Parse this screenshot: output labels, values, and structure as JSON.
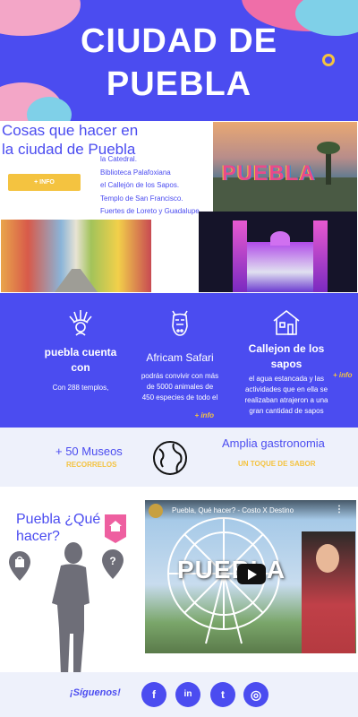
{
  "hero": {
    "title_line1": "CIUDAD DE",
    "title_line2": "PUEBLA"
  },
  "intro": {
    "heading": "Cosas que hacer en la ciudad de Puebla",
    "more_button": "+ INFO",
    "places": [
      "la Catedral.",
      "Biblioteca Palafoxiana",
      "el Callejón de los Sapos.",
      "Templo de San Francisco.",
      "Fuertes de Loreto y Guadalupe."
    ]
  },
  "photos": {
    "sign_text": "PUEBLA"
  },
  "features": [
    {
      "icon": "headdress-icon",
      "title": "puebla cuenta con",
      "text": "Con 288 templos,"
    },
    {
      "icon": "zebra-icon",
      "title": "Africam Safari",
      "text": "podrás convivir con más de 5000 animales de 450 especies de todo el",
      "more": "+ info"
    },
    {
      "icon": "house-icon",
      "title": "Callejon de los sapos",
      "text": "el agua estancada y las actividades que en ella se realizaban atrajeron a una gran cantidad de sapos",
      "more": "+ info"
    }
  ],
  "stats": {
    "museums": "+ 50 Museos",
    "museums_cta": "RECORRELOS",
    "gastro": "Amplia gastronomia",
    "gastro_cta": "UN TOQUE DE SABOR",
    "globe_icon": "globe-icon"
  },
  "plan": {
    "heading": "Puebla ¿Qué hacer?",
    "video_title": "Puebla, Qué hacer? - Costo X Destino",
    "video_overlay": "PUEBLA"
  },
  "footer": {
    "follow": "¡Síguenos!",
    "social": [
      {
        "icon": "facebook-icon",
        "glyph": "f"
      },
      {
        "icon": "linkedin-icon",
        "glyph": "in"
      },
      {
        "icon": "twitter-icon",
        "glyph": "t"
      },
      {
        "icon": "instagram-icon",
        "glyph": "◎"
      }
    ]
  },
  "colors": {
    "brand": "#4b4cf0",
    "accent": "#f4c340",
    "pink": "#ee5fa0",
    "light": "#eef1fb"
  }
}
